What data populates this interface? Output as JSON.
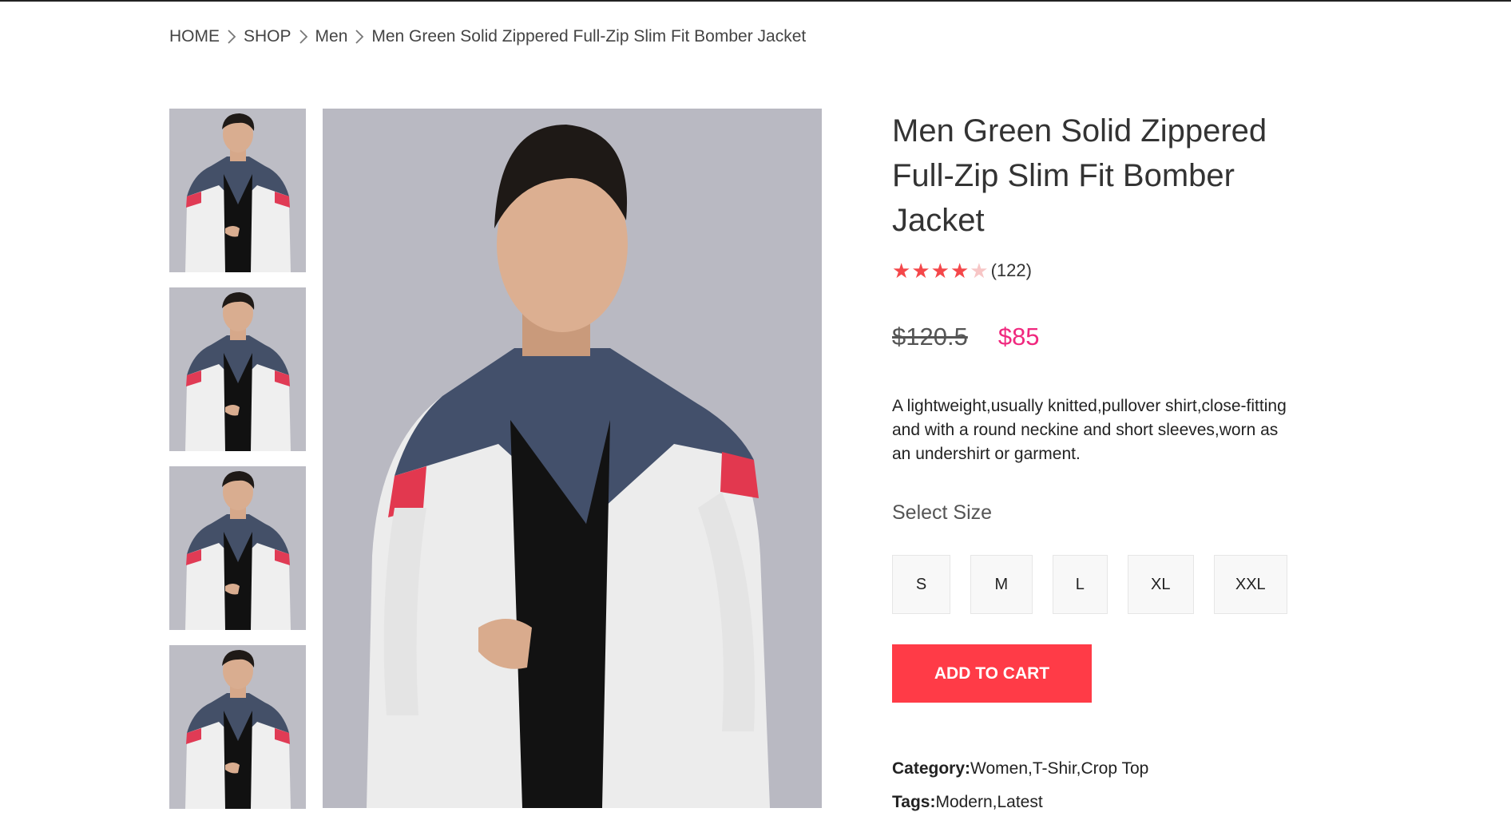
{
  "breadcrumb": {
    "items": [
      "HOME",
      "SHOP",
      "Men",
      "Men Green Solid Zippered Full-Zip Slim Fit Bomber Jacket"
    ]
  },
  "product": {
    "title": "Men Green Solid Zippered Full-Zip Slim Fit Bomber Jacket",
    "rating": 4.5,
    "rating_max": 5,
    "review_count": "(122)",
    "old_price": "$120.5",
    "new_price": "$85",
    "description": "A lightweight,usually knitted,pullover shirt,close-fitting and with a round neckine and short sleeves,worn as an undershirt or garment.",
    "size_title": "Select Size",
    "sizes": [
      "S",
      "M",
      "L",
      "XL",
      "XXL"
    ],
    "add_to_cart": "ADD TO CART",
    "category_label": "Category:",
    "category_value": "Women,T-Shir,Crop Top",
    "tags_label": "Tags:",
    "tags_value": "Modern,Latest"
  },
  "colors": {
    "accent_red": "#ff3b47",
    "price_pink": "#f0287e",
    "star": "#f4474a"
  }
}
